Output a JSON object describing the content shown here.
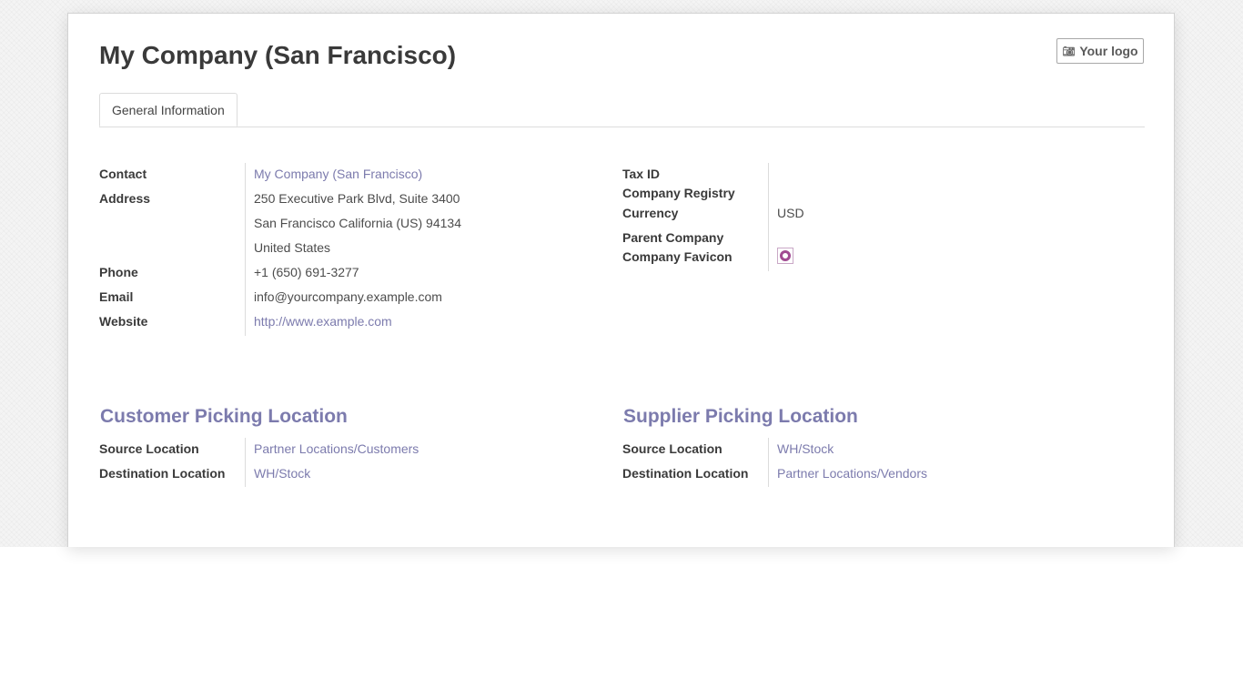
{
  "record": {
    "title": "My Company (San Francisco)"
  },
  "logo_button": {
    "label": "Your logo",
    "icon": "camera-icon"
  },
  "tabs": [
    {
      "label": "General Information",
      "active": true
    }
  ],
  "general": {
    "contact": {
      "label": "Contact",
      "value": "My Company (San Francisco)"
    },
    "address": {
      "label": "Address",
      "line1": "250 Executive Park Blvd, Suite 3400",
      "line2": "San Francisco  California (US)  94134",
      "line3": "United States"
    },
    "phone": {
      "label": "Phone",
      "value": "+1 (650) 691-3277"
    },
    "email": {
      "label": "Email",
      "value": "info@yourcompany.example.com"
    },
    "website": {
      "label": "Website",
      "value": "http://www.example.com"
    }
  },
  "fiscal": {
    "tax_id": {
      "label": "Tax ID",
      "value": ""
    },
    "registry": {
      "label": "Company Registry",
      "value": ""
    },
    "currency": {
      "label": "Currency",
      "value": "USD"
    },
    "parent": {
      "label": "Parent Company",
      "value": ""
    },
    "favicon": {
      "label": "Company Favicon",
      "icon": "favicon-icon"
    }
  },
  "customer_picking": {
    "title": "Customer Picking Location",
    "source": {
      "label": "Source Location",
      "value": "Partner Locations/Customers"
    },
    "destination": {
      "label": "Destination Location",
      "value": "WH/Stock"
    }
  },
  "supplier_picking": {
    "title": "Supplier Picking Location",
    "source": {
      "label": "Source Location",
      "value": "WH/Stock"
    },
    "destination": {
      "label": "Destination Location",
      "value": "Partner Locations/Vendors"
    }
  },
  "colors": {
    "accent": "#7c7bad",
    "favicon": "#a14b92",
    "text": "#4c4c4c"
  }
}
